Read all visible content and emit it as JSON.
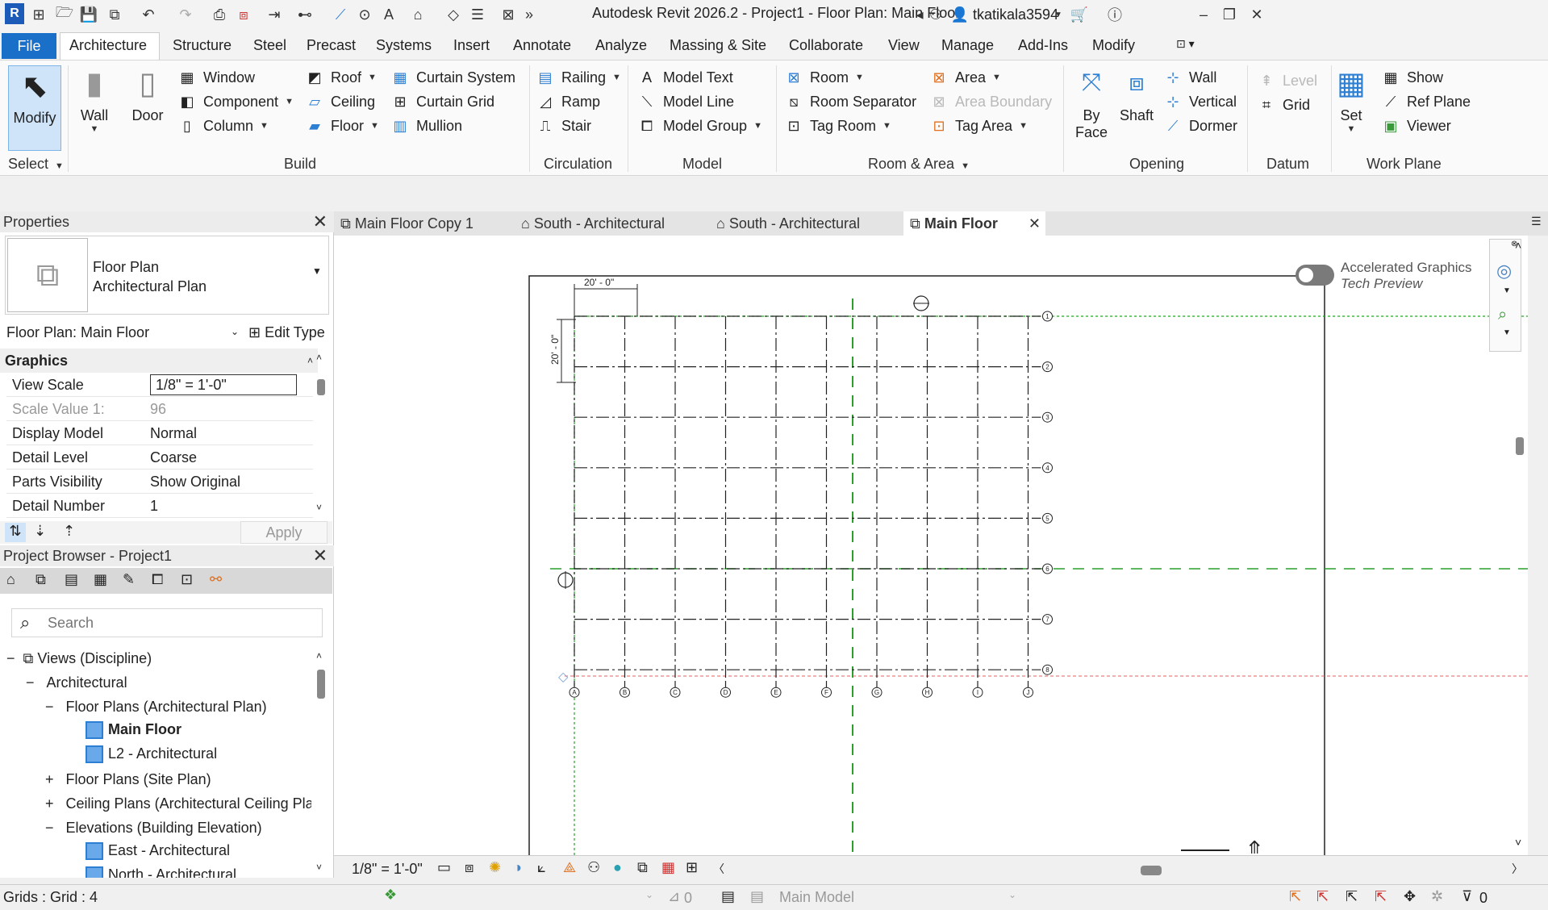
{
  "titlebar": {
    "app_title": "Autodesk Revit 2026.2 - Project1 - Floor Plan: Main Floor",
    "username": "tkatikala3594",
    "logo_letter": "R"
  },
  "menu": {
    "file": "File",
    "tabs": [
      "Architecture",
      "Structure",
      "Steel",
      "Precast",
      "Systems",
      "Insert",
      "Annotate",
      "Analyze",
      "Massing & Site",
      "Collaborate",
      "View",
      "Manage",
      "Add-Ins",
      "Modify"
    ]
  },
  "ribbon": {
    "modify": "Modify",
    "select": "Select",
    "wall": "Wall",
    "door": "Door",
    "window": "Window",
    "component": "Component",
    "column": "Column",
    "roof": "Roof",
    "ceiling": "Ceiling",
    "floor": "Floor",
    "curtain_system": "Curtain  System",
    "curtain_grid": "Curtain  Grid",
    "mullion": "Mullion",
    "build": "Build",
    "railing": "Railing",
    "ramp": "Ramp",
    "stair": "Stair",
    "circulation": "Circulation",
    "model_text": "Model  Text",
    "model_line": "Model  Line",
    "model_group": "Model  Group",
    "model": "Model",
    "room": "Room",
    "room_separator": "Room  Separator",
    "tag_room": "Tag  Room",
    "area": "Area",
    "area_boundary": "Area  Boundary",
    "tag_area": "Tag  Area",
    "room_area": "Room & Area",
    "by_face_1": "By",
    "by_face_2": "Face",
    "shaft": "Shaft",
    "op_wall": "Wall",
    "vertical": "Vertical",
    "dormer": "Dormer",
    "opening": "Opening",
    "level": "Level",
    "grid": "Grid",
    "datum": "Datum",
    "set": "Set",
    "show": "Show",
    "ref_plane": "Ref  Plane",
    "viewer": "Viewer",
    "work_plane": "Work Plane"
  },
  "properties": {
    "header": "Properties",
    "type_line1": "Floor Plan",
    "type_line2": "Architectural Plan",
    "instance": "Floor Plan: Main Floor",
    "edit_type": "Edit Type",
    "section": "Graphics",
    "rows": [
      {
        "k": "View Scale",
        "v": "1/8\" = 1'-0\""
      },
      {
        "k": "Scale Value    1:",
        "v": "96"
      },
      {
        "k": "Display Model",
        "v": "Normal"
      },
      {
        "k": "Detail Level",
        "v": "Coarse"
      },
      {
        "k": "Parts Visibility",
        "v": "Show Original"
      },
      {
        "k": "Detail Number",
        "v": "1"
      }
    ],
    "apply": "Apply"
  },
  "browser": {
    "header": "Project Browser - Project1",
    "search_placeholder": "Search",
    "views": "Views (Discipline)",
    "architectural": "Architectural",
    "floor_plans_arch": "Floor Plans (Architectural Plan)",
    "main_floor": "Main Floor",
    "l2": "L2 - Architectural",
    "floor_plans_site": "Floor Plans (Site Plan)",
    "ceiling_plans": "Ceiling Plans (Architectural Ceiling Pla",
    "elevations": "Elevations (Building Elevation)",
    "east": "East - Architectural",
    "north": "North - Architectural"
  },
  "view_tabs": [
    "Main Floor Copy 1",
    "South - Architectural",
    "South - Architectural",
    "Main Floor"
  ],
  "canvas": {
    "accel_line1": "Accelerated Graphics",
    "accel_line2": "Tech Preview",
    "dim_h": "20' - 0\"",
    "dim_v": "20' - 0\"",
    "col_labels": [
      "A",
      "B",
      "C",
      "D",
      "E",
      "F",
      "G",
      "H",
      "I",
      "J"
    ],
    "row_labels": [
      "1",
      "2",
      "3",
      "4",
      "5",
      "6",
      "7",
      "8"
    ]
  },
  "view_status": {
    "scale": "1/8\" = 1'-0\""
  },
  "statusbar": {
    "text": "Grids : Grid : 4",
    "worksets": "0",
    "model": "Main Model",
    "filter": "0"
  }
}
